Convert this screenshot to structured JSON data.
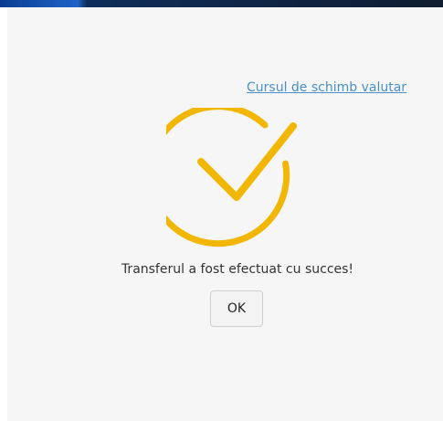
{
  "header": {
    "accent_colors": [
      "#0b3d91",
      "#101c30"
    ]
  },
  "links": {
    "exchange_rate": "Cursul de schimb valutar"
  },
  "dialog": {
    "status_icon": "success-check-icon",
    "icon_color": "#F2B705",
    "message": "Transferul a fost efectuat cu succes!",
    "ok_label": "OK"
  }
}
